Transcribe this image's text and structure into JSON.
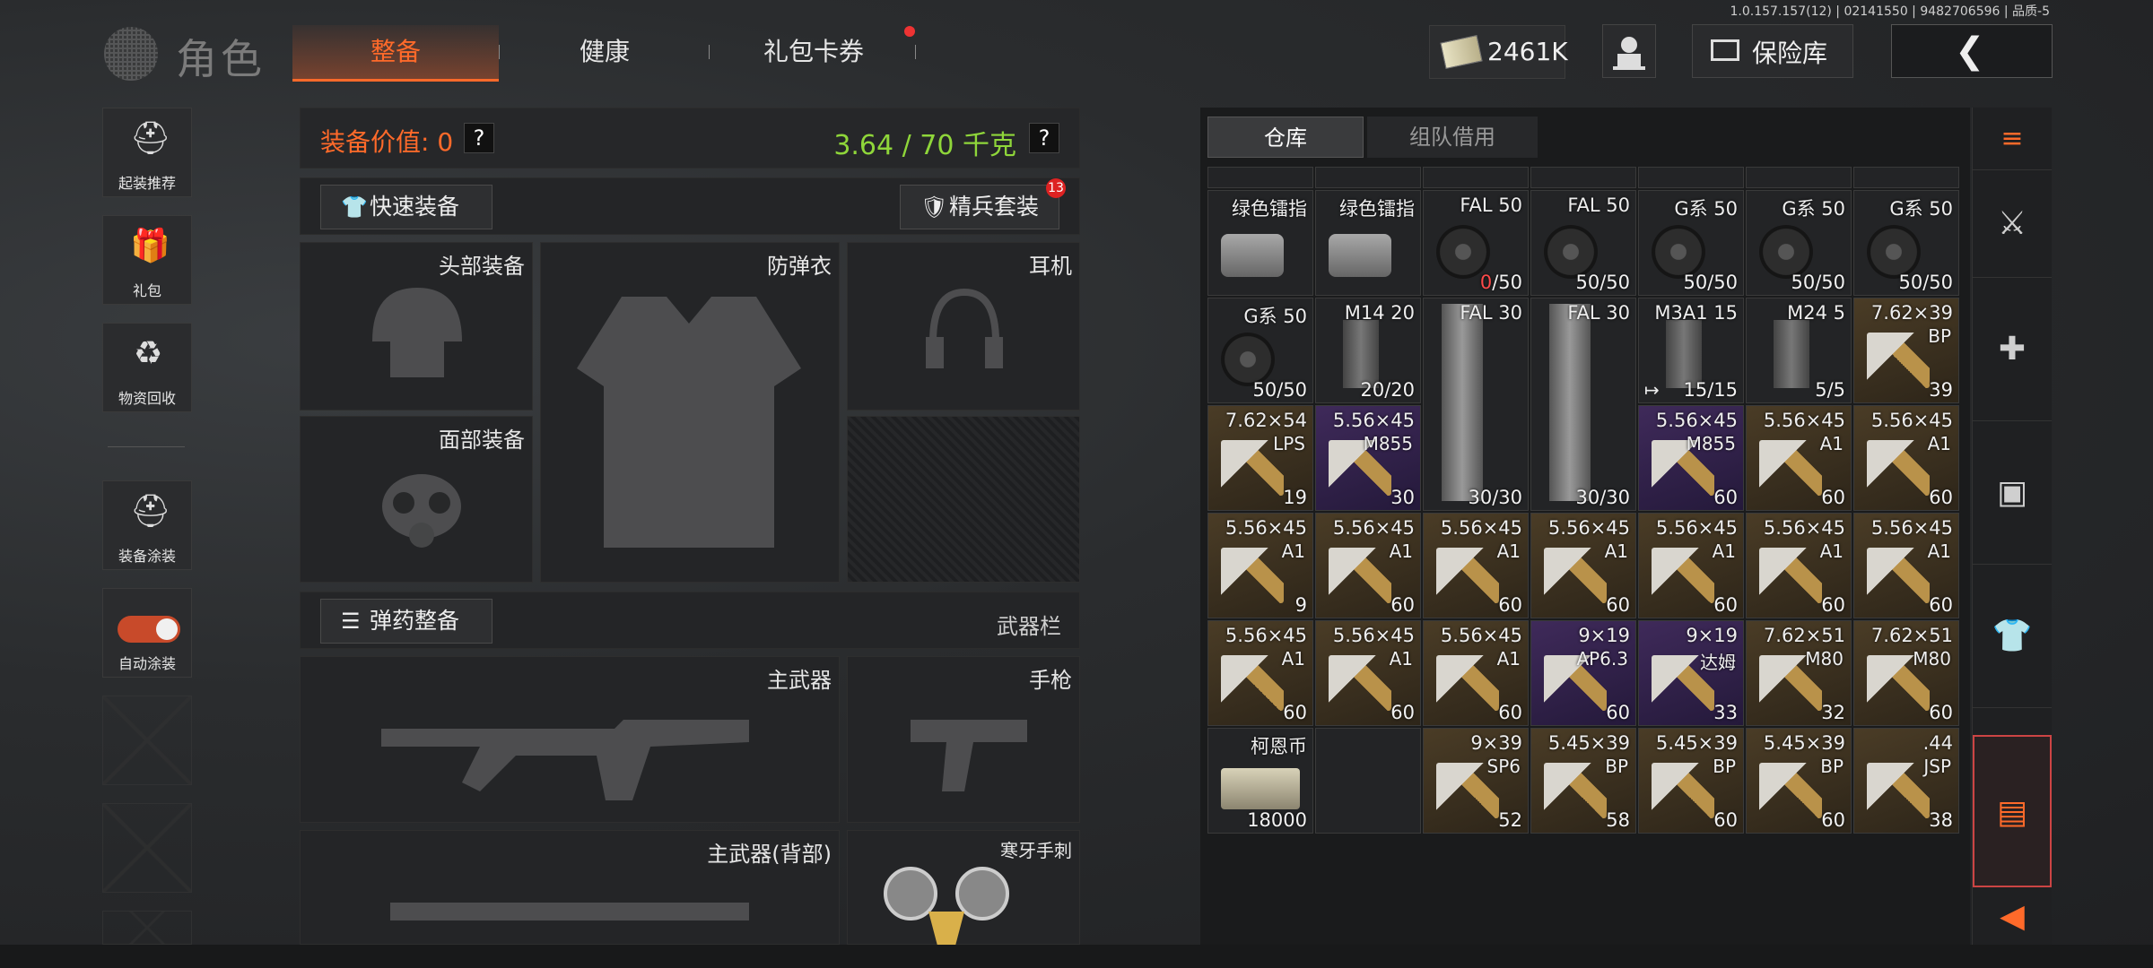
{
  "version": "1.0.157.157(12) | 02141550 | 9482706596 | 品质-5",
  "header": {
    "title": "角色",
    "tabs": [
      "整备",
      "健康",
      "礼包卡券"
    ],
    "currency": "2461K",
    "vault_label": "保险库",
    "back_icon": "chevron-left-icon"
  },
  "sidebar": {
    "items": [
      {
        "label": "起装推荐",
        "icon": "helmet-gear-icon"
      },
      {
        "label": "礼包",
        "icon": "gift-icon"
      },
      {
        "label": "物资回收",
        "icon": "recycle-icon"
      },
      {
        "label": "装备涂装",
        "icon": "helmet-paint-icon"
      },
      {
        "label": "自动涂装",
        "icon": "toggle-icon"
      }
    ],
    "auto_paint_on": true
  },
  "equipment": {
    "value_label": "装备价值: 0",
    "weight": "3.64 / 70 千克",
    "help": "?",
    "quick_equip": "快速装备",
    "elite_set": "精兵套装",
    "elite_badge": "13",
    "slots": {
      "head": "头部装备",
      "armor": "防弹衣",
      "ears": "耳机",
      "face": "面部装备",
      "primary": "主武器",
      "pistol": "手枪",
      "primary_back": "主武器(背部)",
      "melee": "寒牙手刺"
    },
    "ammo_equip": "弹药整备",
    "weapon_bar": "武器栏"
  },
  "inventory": {
    "tabs": [
      "仓库",
      "组队借用"
    ],
    "rows": [
      [
        {
          "name": "绿色镭指",
          "sub": "",
          "count": "",
          "type": "device",
          "bg": "dark"
        },
        {
          "name": "绿色镭指",
          "sub": "",
          "count": "",
          "type": "device",
          "bg": "dark"
        },
        {
          "name": "FAL 50",
          "sub": "",
          "count": "0/50",
          "empty": true,
          "type": "drum",
          "bg": "dark"
        },
        {
          "name": "FAL 50",
          "sub": "",
          "count": "50/50",
          "type": "drum",
          "bg": "dark"
        },
        {
          "name": "G系 50",
          "sub": "",
          "count": "50/50",
          "type": "drum",
          "bg": "dark"
        },
        {
          "name": "G系 50",
          "sub": "",
          "count": "50/50",
          "type": "drum",
          "bg": "dark"
        },
        {
          "name": "G系 50",
          "sub": "",
          "count": "50/50",
          "type": "drum",
          "bg": "dark"
        }
      ],
      [
        {
          "name": "G系 50",
          "sub": "",
          "count": "50/50",
          "type": "drum",
          "bg": "dark"
        },
        {
          "name": "M14 20",
          "sub": "",
          "count": "20/20",
          "type": "mag",
          "bg": "dark"
        },
        {
          "name": "FAL 30",
          "sub": "",
          "count": "30/30",
          "type": "tall",
          "bg": "dark",
          "span": 2
        },
        {
          "name": "FAL 30",
          "sub": "",
          "count": "30/30",
          "type": "tall",
          "bg": "dark",
          "span": 2
        },
        {
          "name": "M3A1 15",
          "sub": "",
          "count": "15/15",
          "type": "mag",
          "bg": "dark",
          "link": true
        },
        {
          "name": "M24 5",
          "sub": "",
          "count": "5/5",
          "type": "mag",
          "bg": "dark"
        },
        {
          "name": "7.62×39",
          "sub": "BP",
          "count": "39",
          "type": "ammo",
          "bg": "brown"
        }
      ],
      [
        {
          "name": "7.62×54",
          "sub": "LPS",
          "count": "19",
          "type": "ammo",
          "bg": "brown"
        },
        {
          "name": "5.56×45",
          "sub": "M855",
          "count": "30",
          "type": "ammo",
          "bg": "purple"
        },
        null,
        null,
        {
          "name": "5.56×45",
          "sub": "M855",
          "count": "60",
          "type": "ammo",
          "bg": "purple"
        },
        {
          "name": "5.56×45",
          "sub": "A1",
          "count": "60",
          "type": "ammo",
          "bg": "brown"
        },
        {
          "name": "5.56×45",
          "sub": "A1",
          "count": "60",
          "type": "ammo",
          "bg": "brown"
        }
      ],
      [
        {
          "name": "5.56×45",
          "sub": "A1",
          "count": "9",
          "type": "ammo",
          "bg": "brown"
        },
        {
          "name": "5.56×45",
          "sub": "A1",
          "count": "60",
          "type": "ammo",
          "bg": "brown"
        },
        {
          "name": "5.56×45",
          "sub": "A1",
          "count": "60",
          "type": "ammo",
          "bg": "brown"
        },
        {
          "name": "5.56×45",
          "sub": "A1",
          "count": "60",
          "type": "ammo",
          "bg": "brown"
        },
        {
          "name": "5.56×45",
          "sub": "A1",
          "count": "60",
          "type": "ammo",
          "bg": "brown"
        },
        {
          "name": "5.56×45",
          "sub": "A1",
          "count": "60",
          "type": "ammo",
          "bg": "brown"
        },
        {
          "name": "5.56×45",
          "sub": "A1",
          "count": "60",
          "type": "ammo",
          "bg": "brown"
        }
      ],
      [
        {
          "name": "5.56×45",
          "sub": "A1",
          "count": "60",
          "type": "ammo",
          "bg": "brown"
        },
        {
          "name": "5.56×45",
          "sub": "A1",
          "count": "60",
          "type": "ammo",
          "bg": "brown"
        },
        {
          "name": "5.56×45",
          "sub": "A1",
          "count": "60",
          "type": "ammo",
          "bg": "brown"
        },
        {
          "name": "9×19",
          "sub": "AP6.3",
          "count": "60",
          "type": "ammo",
          "bg": "purple"
        },
        {
          "name": "9×19",
          "sub": "达姆",
          "count": "33",
          "type": "ammo",
          "bg": "purple"
        },
        {
          "name": "7.62×51",
          "sub": "M80",
          "count": "32",
          "type": "ammo",
          "bg": "brown"
        },
        {
          "name": "7.62×51",
          "sub": "M80",
          "count": "60",
          "type": "ammo",
          "bg": "brown"
        }
      ],
      [
        {
          "name": "柯恩币",
          "sub": "",
          "count": "18000",
          "type": "cash",
          "bg": "dark"
        },
        null,
        {
          "name": "9×39",
          "sub": "SP6",
          "count": "52",
          "type": "ammo",
          "bg": "brown"
        },
        {
          "name": "5.45×39",
          "sub": "BP",
          "count": "58",
          "type": "ammo",
          "bg": "brown"
        },
        {
          "name": "5.45×39",
          "sub": "BP",
          "count": "60",
          "type": "ammo",
          "bg": "brown"
        },
        {
          "name": "5.45×39",
          "sub": "BP",
          "count": "60",
          "type": "ammo",
          "bg": "brown"
        },
        {
          "name": ".44",
          "sub": "JSP",
          "count": "38",
          "type": "ammo",
          "bg": "brown"
        }
      ]
    ]
  },
  "categories": [
    "filter-icon",
    "rifle-icon",
    "medkit-icon",
    "box-icon",
    "shirt-icon",
    "crate-icon",
    "collapse-icon"
  ],
  "colors": {
    "accent": "#ff6a2a",
    "weight": "#8fd63a",
    "purple": "#3f2a5a",
    "brown": "#4a3c26"
  }
}
